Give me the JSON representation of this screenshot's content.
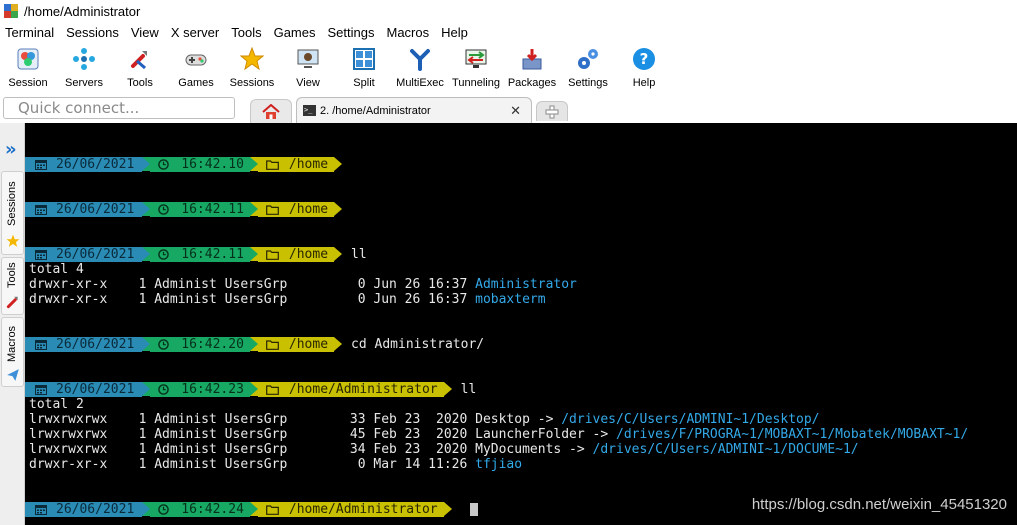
{
  "window": {
    "title": "/home/Administrator"
  },
  "menu": [
    "Terminal",
    "Sessions",
    "View",
    "X server",
    "Tools",
    "Games",
    "Settings",
    "Macros",
    "Help"
  ],
  "toolbar": [
    {
      "label": "Session",
      "icon": "session-icon"
    },
    {
      "label": "Servers",
      "icon": "servers-icon"
    },
    {
      "label": "Tools",
      "icon": "tools-icon"
    },
    {
      "label": "Games",
      "icon": "games-icon"
    },
    {
      "label": "Sessions",
      "icon": "star-icon"
    },
    {
      "label": "View",
      "icon": "view-icon"
    },
    {
      "label": "Split",
      "icon": "split-icon"
    },
    {
      "label": "MultiExec",
      "icon": "multiexec-icon"
    },
    {
      "label": "Tunneling",
      "icon": "tunneling-icon"
    },
    {
      "label": "Packages",
      "icon": "packages-icon"
    },
    {
      "label": "Settings",
      "icon": "settings-icon"
    },
    {
      "label": "Help",
      "icon": "help-icon"
    }
  ],
  "quick_connect": {
    "placeholder": "Quick connect..."
  },
  "tabs": {
    "active_label": "2. /home/Administrator"
  },
  "sidebar": {
    "tabs": [
      "Sessions",
      "Tools",
      "Macros"
    ]
  },
  "terminal": {
    "prompts": [
      {
        "date": "26/06/2021",
        "time": "16:42.10",
        "path": "/home",
        "command": ""
      },
      {
        "date": "26/06/2021",
        "time": "16:42.11",
        "path": "/home",
        "command": ""
      },
      {
        "date": "26/06/2021",
        "time": "16:42.11",
        "path": "/home",
        "command": "ll"
      },
      {
        "date": "26/06/2021",
        "time": "16:42.20",
        "path": "/home",
        "command": "cd Administrator/"
      },
      {
        "date": "26/06/2021",
        "time": "16:42.23",
        "path": "/home/Administrator",
        "command": "ll"
      },
      {
        "date": "26/06/2021",
        "time": "16:42.24",
        "path": "/home/Administrator",
        "command": ""
      }
    ],
    "output1": {
      "total": "total 4",
      "rows": [
        {
          "meta": "drwxr-xr-x    1 Administ UsersGrp         0 Jun 26 16:37 ",
          "name": "Administrator",
          "target": ""
        },
        {
          "meta": "drwxr-xr-x    1 Administ UsersGrp         0 Jun 26 16:37 ",
          "name": "mobaxterm",
          "target": ""
        }
      ]
    },
    "output2": {
      "total": "total 2",
      "rows": [
        {
          "meta": "lrwxrwxrwx    1 Administ UsersGrp        33 Feb 23  2020 ",
          "name": "Desktop -> ",
          "target": "/drives/C/Users/ADMINI~1/Desktop/"
        },
        {
          "meta": "lrwxrwxrwx    1 Administ UsersGrp        45 Feb 23  2020 ",
          "name": "LauncherFolder -> ",
          "target": "/drives/F/PROGRA~1/MOBAXT~1/Mobatek/MOBAXT~1/"
        },
        {
          "meta": "lrwxrwxrwx    1 Administ UsersGrp        34 Feb 23  2020 ",
          "name": "MyDocuments -> ",
          "target": "/drives/C/Users/ADMINI~1/DOCUME~1/"
        },
        {
          "meta": "drwxr-xr-x    1 Administ UsersGrp         0 Mar 14 11:26 ",
          "name": "",
          "target": "tfjiao"
        }
      ]
    }
  },
  "watermark": "https://blog.csdn.net/weixin_45451320",
  "colors": {
    "date_seg": "#2a8bb5",
    "time_seg": "#17a864",
    "path_seg": "#c8c000",
    "link": "#33a9e8"
  }
}
